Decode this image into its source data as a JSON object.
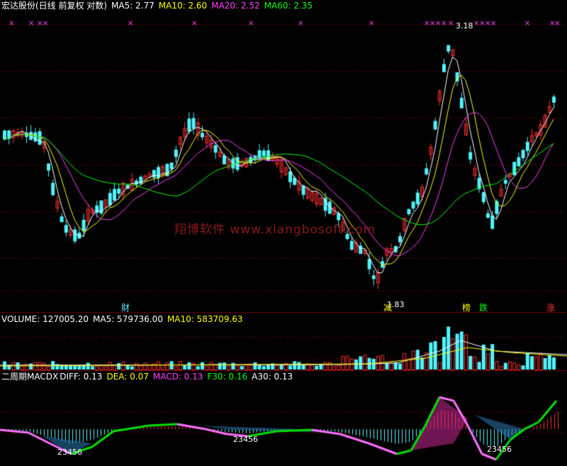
{
  "colors": {
    "bg": "#000000",
    "up": "#ff3030",
    "down": "#4ff4ff",
    "grid": "#700000",
    "ma5": "#ffffff",
    "ma10": "#ffff00",
    "ma20": "#ff40ff",
    "ma60": "#00ff00",
    "white_text": "#ffffff",
    "watermark": "#8a1a1a"
  },
  "price_panel": {
    "stock_name": "宏达股份(日线 前复权 对数)",
    "ma5": "MA5: 2.77",
    "ma10": "MA10: 2.60",
    "ma20": "MA20: 2.52",
    "ma60": "MA60: 2.35",
    "high_label": "3.18",
    "low_label": "1.83",
    "watermark": "翔博软件 www.xiangbosoft.com",
    "markers": [
      {
        "text": "财",
        "color": "#4ff4ff"
      },
      {
        "text": "减",
        "color": "#ffff00"
      },
      {
        "text": "榜",
        "color": "#ffff00"
      },
      {
        "text": "跌",
        "color": "#00ff00"
      },
      {
        "text": "涨",
        "color": "#ff3030"
      }
    ]
  },
  "volume_panel": {
    "volume": "VOLUME: 127005.20",
    "ma5": "MA5: 579736.00",
    "ma10": "MA10: 583709.63"
  },
  "macd_panel": {
    "title": "二周期MACDX",
    "diff": "DIFF: 0.13",
    "dea": "DEA: 0.07",
    "macd": "MACD: 0.13",
    "f30": "F30: 0.16",
    "a30": "A30: 0.13",
    "counts": [
      "23456",
      "23456",
      "23456"
    ]
  }
}
